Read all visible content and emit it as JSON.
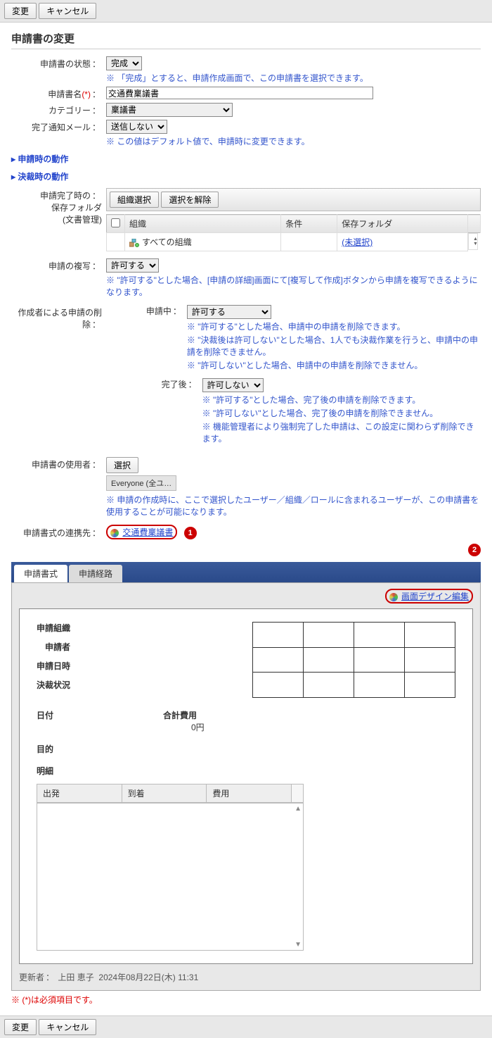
{
  "buttons": {
    "change": "変更",
    "cancel": "キャンセル",
    "select_org": "組織選択",
    "deselect": "選択を解除",
    "select": "選択"
  },
  "page_title": "申請書の変更",
  "status": {
    "label": "申請書の状態",
    "value": "完成",
    "note": "※ 「完成」とすると、申請作成画面で、この申請書を選択できます。"
  },
  "name": {
    "label": "申請書名",
    "req": "(*)",
    "value": "交通費稟議書"
  },
  "category": {
    "label": "カテゴリー",
    "value": "稟議書"
  },
  "notify": {
    "label": "完了通知メール",
    "value": "送信しない",
    "note": "※ この値はデフォルト値で、申請時に変更できます。"
  },
  "collapse1": "申請時の動作",
  "collapse2": "決裁時の動作",
  "folder": {
    "label1": "申請完了時の",
    "label2": "保存フォルダ",
    "label3": "(文書管理)",
    "th_org": "組織",
    "th_cond": "条件",
    "th_folder": "保存フォルダ",
    "row_org": "すべての組織",
    "row_link": "(未選択)"
  },
  "copy": {
    "label": "申請の複写",
    "value": "許可する",
    "note": "※ \"許可する\"とした場合、[申請の詳細]画面にて[複写して作成]ボタンから申請を複写できるようになります。"
  },
  "delete": {
    "label": "作成者による申請の削除",
    "mid_label": "申請中",
    "mid_value": "許可する",
    "mid_n1": "※ \"許可する\"とした場合、申請中の申請を削除できます。",
    "mid_n2": "※ \"決裁後は許可しない\"とした場合、1人でも決裁作業を行うと、申請中の申請を削除できません。",
    "mid_n3": "※ \"許可しない\"とした場合、申請中の申請を削除できません。",
    "done_label": "完了後",
    "done_value": "許可しない",
    "done_n1": "※ \"許可する\"とした場合、完了後の申請を削除できます。",
    "done_n2": "※ \"許可しない\"とした場合、完了後の申請を削除できません。",
    "done_n3": "※ 機能管理者により強制完了した申請は、この設定に関わらず削除できます。"
  },
  "users": {
    "label": "申請書の使用者",
    "chip": "Everyone (全ユ…",
    "note": "※ 申請の作成時に、ここで選択したユーザー／組織／ロールに含まれるユーザーが、この申請書を使用することが可能になります。"
  },
  "link": {
    "label": "申請書式の連携先",
    "text": "交通費稟議書"
  },
  "marker1": "1",
  "marker2": "2",
  "tabs": {
    "form": "申請書式",
    "route": "申請経路"
  },
  "design_link": "画面デザイン編集",
  "preview": {
    "org": "申請組織",
    "person": "申請者",
    "datetime": "申請日時",
    "status": "決裁状況",
    "date": "日付",
    "total": "合計費用",
    "total_val": "0円",
    "purpose": "目的",
    "detail": "明細",
    "dep": "出発",
    "arr": "到着",
    "cost": "費用"
  },
  "updater": {
    "label": "更新者",
    "name": "上田 恵子",
    "date": "2024年08月22日(木) 11:31"
  },
  "req_note": "※ (*)は必須項目です。"
}
